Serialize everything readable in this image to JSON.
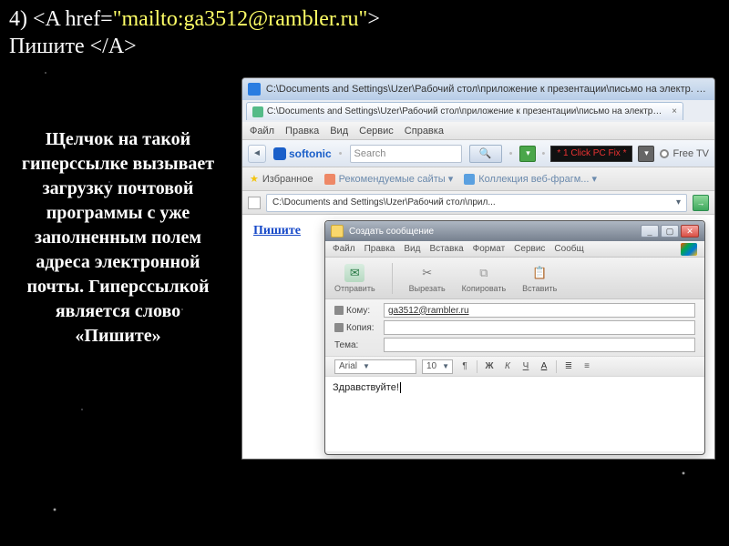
{
  "slide": {
    "number": "4) ",
    "code_open": "<A href=",
    "code_mailto": "\"mailto:ga3512@rambler.ru\"",
    "code_gt": ">",
    "code_text": "Пишите ",
    "code_close": "</A>",
    "explain": "Щелчок на такой гиперссылке вызывает загрузку почтовой программы с уже заполненным  полем адреса электронной почты. Гиперссылкой является слово «Пишите»"
  },
  "browser": {
    "title_path": "C:\\Documents and Settings\\Uzer\\Рабочий стол\\приложение к презентации\\письмо на электр. адр",
    "tab_label": "C:\\Documents and Settings\\Uzer\\Рабочий стол\\приложение к презентации\\письмо на электр. ад",
    "menus": {
      "file": "Файл",
      "edit": "Правка",
      "view": "Вид",
      "service": "Сервис",
      "help": "Справка"
    },
    "softonic_label": "softonic",
    "search_placeholder": "Search",
    "promo_text": "* 1 Click PC Fix *",
    "freetv_label": "Free TV",
    "favorites_label": "Избранное",
    "rec_sites_label": "Рекомендуемые сайты ▾",
    "kollek_label": "Коллекция веб-фрагм... ▾",
    "address_text": "C:\\Documents and Settings\\Uzer\\Рабочий стол\\прил...",
    "link_text": "Пишите"
  },
  "compose": {
    "title": "Создать сообщение",
    "menus": {
      "file": "Файл",
      "edit": "Правка",
      "view": "Вид",
      "insert": "Вставка",
      "format": "Формат",
      "service": "Сервис",
      "message": "Сообщ"
    },
    "toolbar": {
      "send": "Отправить",
      "cut": "Вырезать",
      "copy": "Копировать",
      "paste": "Вставить"
    },
    "fields": {
      "to_label": "Кому:",
      "to_value": "ga3512@rambler.ru",
      "cc_label": "Копия:",
      "subject_label": "Тема:"
    },
    "format": {
      "font": "Arial",
      "size": "10"
    },
    "body_text": "Здравствуйте!"
  }
}
